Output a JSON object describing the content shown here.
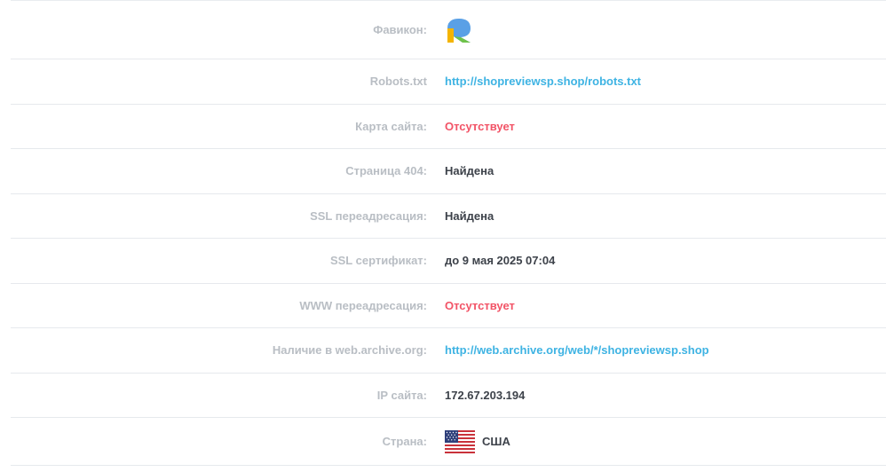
{
  "rows": [
    {
      "key": "favicon",
      "label": "Фавикон:"
    },
    {
      "key": "robots",
      "label": "Robots.txt",
      "value": "http://shopreviewsp.shop/robots.txt"
    },
    {
      "key": "sitemap",
      "label": "Карта сайта:",
      "value": "Отсутствует"
    },
    {
      "key": "page404",
      "label": "Страница 404:",
      "value": "Найдена"
    },
    {
      "key": "ssl_redirect",
      "label": "SSL переадресация:",
      "value": "Найдена"
    },
    {
      "key": "ssl_cert",
      "label": "SSL сертификат:",
      "value": "до 9 мая 2025 07:04"
    },
    {
      "key": "www_redirect",
      "label": "WWW переадресация:",
      "value": "Отсутствует"
    },
    {
      "key": "archive",
      "label": "Наличие в web.archive.org:",
      "value": "http://web.archive.org/web/*/shopreviewsp.shop"
    },
    {
      "key": "ip",
      "label": "IP сайта:",
      "value": "172.67.203.194"
    },
    {
      "key": "country",
      "label": "Страна:",
      "value": "США"
    }
  ],
  "icons": {
    "favicon": "r-logo-icon",
    "country_flag": "us-flag-icon"
  },
  "colors": {
    "label": "#b9bec4",
    "value": "#3d424a",
    "link": "#3eb3e3",
    "missing": "#f25467"
  }
}
